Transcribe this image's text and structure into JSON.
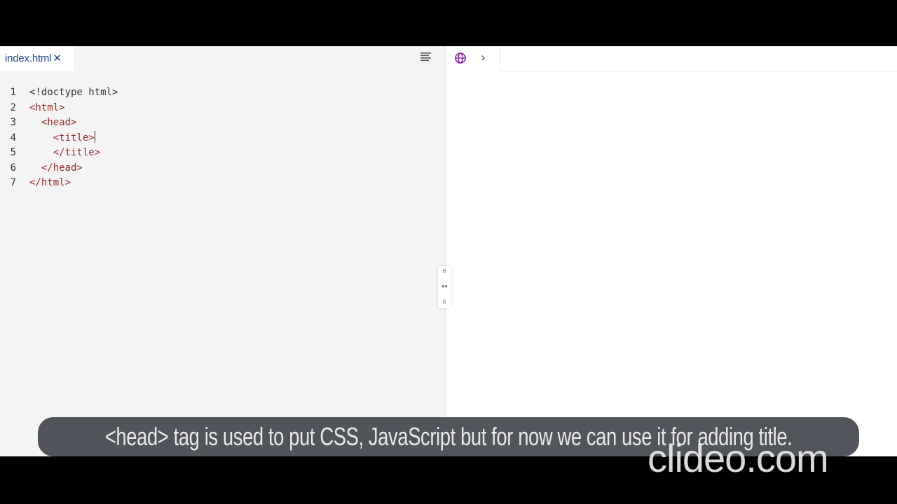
{
  "editor": {
    "tab_label": "index.html",
    "tab_close": "✕",
    "lines": [
      {
        "num": "1",
        "text": "<!doctype html>"
      },
      {
        "num": "2",
        "text": "<html>"
      },
      {
        "num": "3",
        "text": "  <head>"
      },
      {
        "num": "4",
        "text": "    <title>"
      },
      {
        "num": "5",
        "text": "    </title>"
      },
      {
        "num": "6",
        "text": "  </head>"
      },
      {
        "num": "7",
        "text": "</html>"
      }
    ],
    "format_icon": "format-align-icon"
  },
  "preview": {
    "globe_icon": "globe-icon",
    "chevron": "›",
    "url": ""
  },
  "splitter": {
    "arrows": "↔",
    "dots": "⠿"
  },
  "caption": {
    "text": "<head> tag is used to put CSS, JavaScript but for now we can use it for adding title."
  },
  "watermark": {
    "text": "clideo.com"
  },
  "colors": {
    "tag": "#9a2a2a",
    "tab_text": "#1f4b8e",
    "globe": "#8a1fa8"
  }
}
